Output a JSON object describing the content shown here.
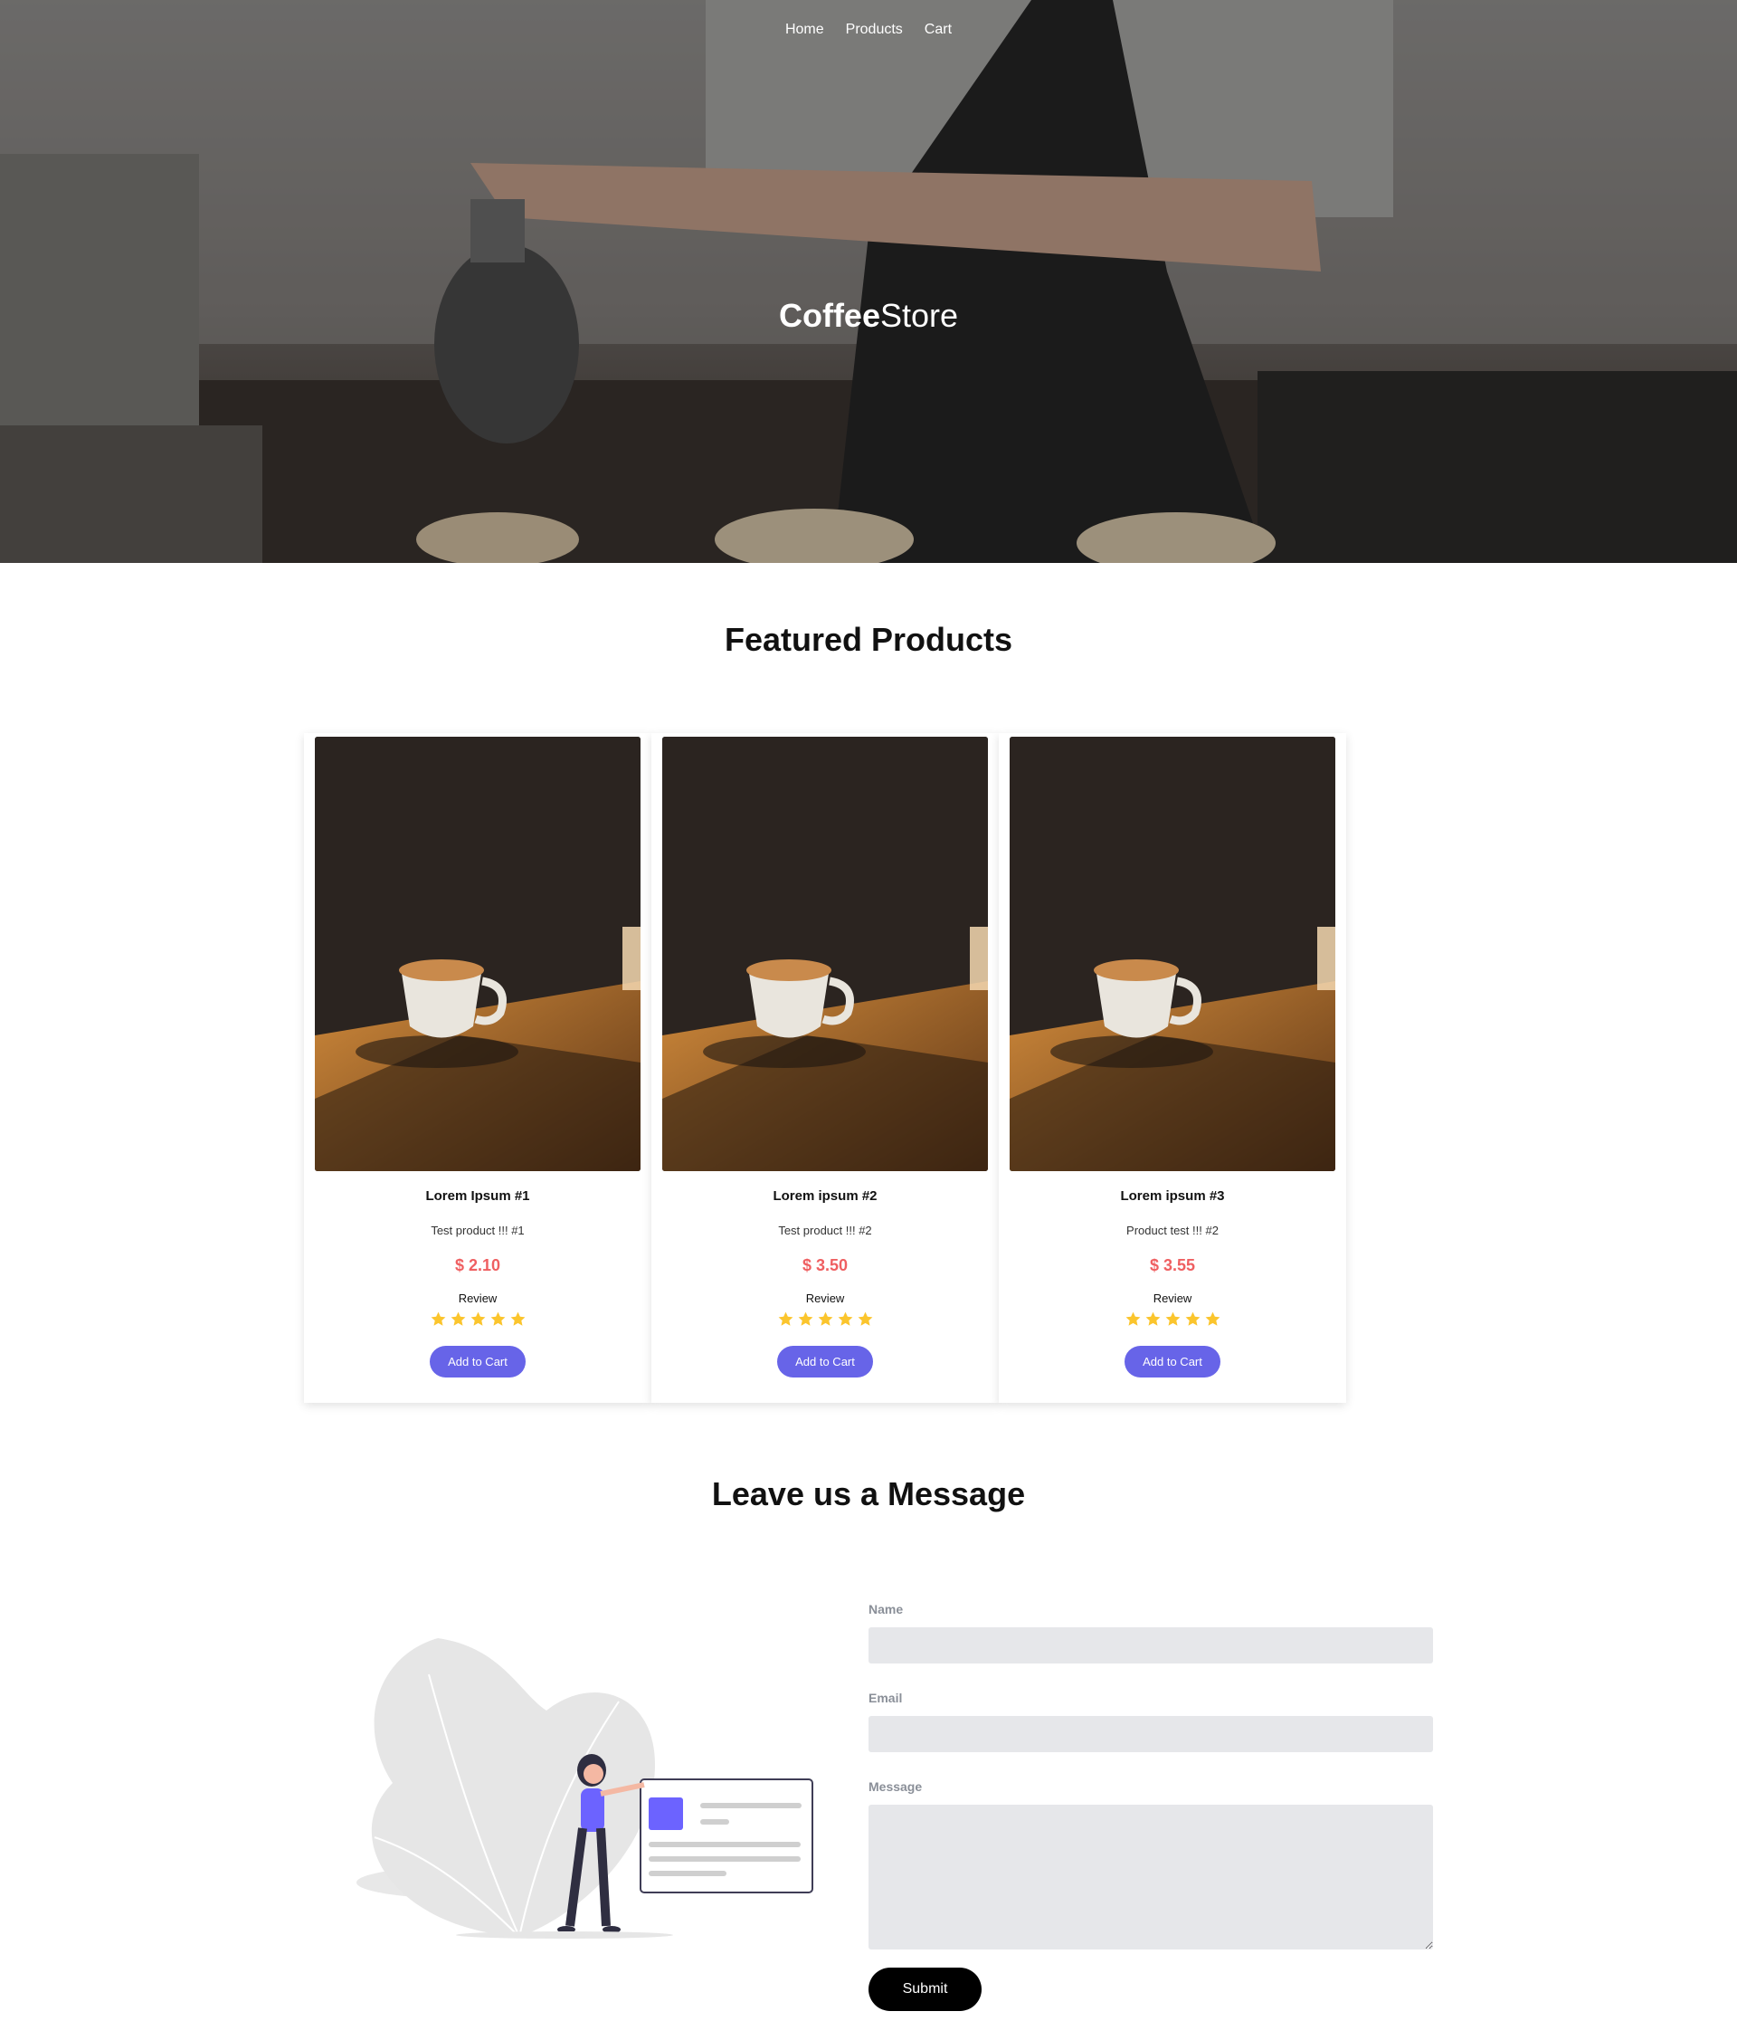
{
  "nav": {
    "items": [
      "Home",
      "Products",
      "Cart"
    ]
  },
  "hero": {
    "brand_bold": "Coffee",
    "brand_light": "Store"
  },
  "featured": {
    "title": "Featured Products"
  },
  "products": [
    {
      "name": "Lorem Ipsum #1",
      "desc": "Test product !!! #1",
      "price": "$ 2.10",
      "review_label": "Review",
      "rating": 5,
      "button": "Add to Cart"
    },
    {
      "name": "Lorem ipsum #2",
      "desc": "Test product !!! #2",
      "price": "$ 3.50",
      "review_label": "Review",
      "rating": 5,
      "button": "Add to Cart"
    },
    {
      "name": "Lorem ipsum #3",
      "desc": "Product test !!! #2",
      "price": "$ 3.55",
      "review_label": "Review",
      "rating": 5,
      "button": "Add to Cart"
    }
  ],
  "message": {
    "title": "Leave us a Message",
    "name_label": "Name",
    "email_label": "Email",
    "message_label": "Message",
    "submit_label": "Submit"
  },
  "colors": {
    "accent": "#6764e8",
    "price": "#ef5f61",
    "star": "#fbc52d",
    "input_bg": "#e6e7ea"
  }
}
